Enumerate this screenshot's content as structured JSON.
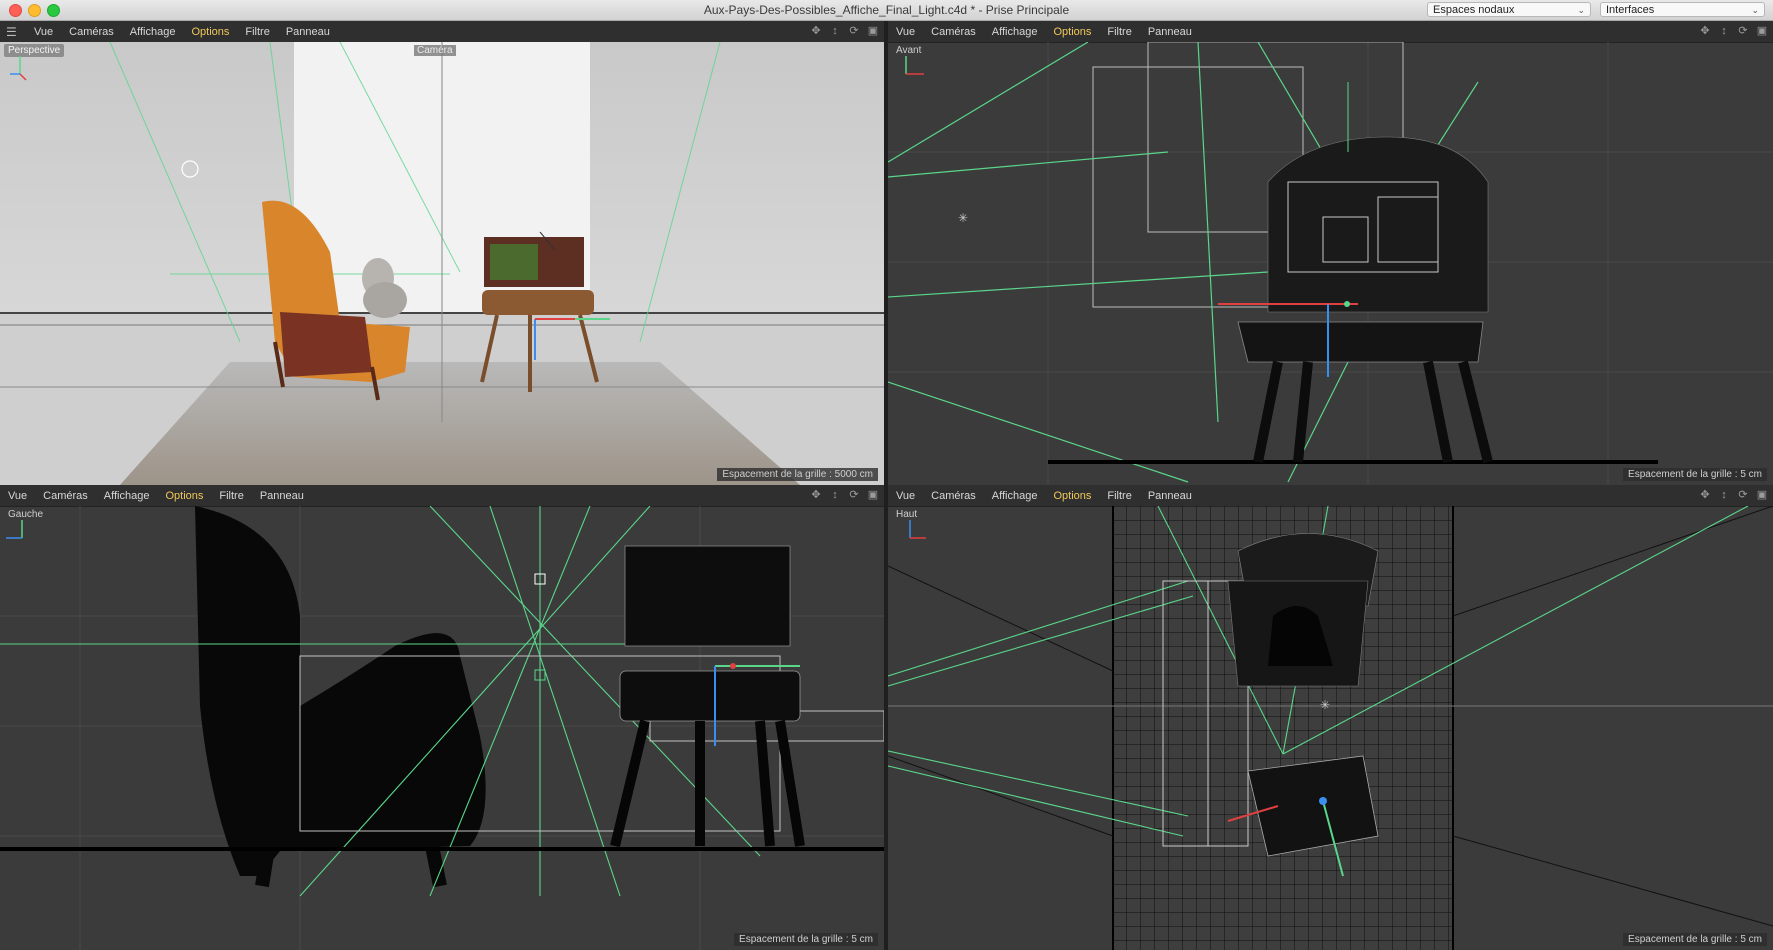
{
  "window": {
    "title": "Aux-Pays-Des-Possibles_Affiche_Final_Light.c4d * - Prise Principale",
    "node_space_select": "Espaces nodaux",
    "layout_select": "Interfaces"
  },
  "menu": [
    "Vue",
    "Caméras",
    "Affichage",
    "Options",
    "Filtre",
    "Panneau"
  ],
  "viewports": {
    "perspective": {
      "label": "Perspective",
      "camera_label": "Caméra",
      "grid": "Espacement de la grille : 5000 cm"
    },
    "front": {
      "label": "Avant",
      "grid": "Espacement de la grille : 5 cm"
    },
    "left": {
      "label": "Gauche",
      "grid": "Espacement de la grille : 5 cm"
    },
    "top": {
      "label": "Haut",
      "grid": "Espacement de la grille : 5 cm"
    }
  },
  "icons": [
    "hamburger-icon",
    "move-icon",
    "dolly-icon",
    "rotate-icon",
    "maximize-icon"
  ],
  "colors": {
    "menu_active": "#f0c85a",
    "guide_green": "#5ad68a",
    "axis_red": "#e04040",
    "axis_blue": "#3a8ef0"
  }
}
